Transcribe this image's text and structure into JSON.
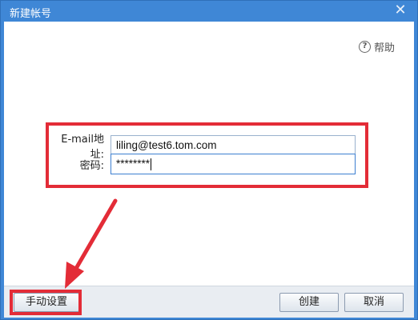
{
  "window": {
    "title": "新建帐号"
  },
  "help": {
    "label": "帮助"
  },
  "form": {
    "email_label": "E-mail地址:",
    "email_value": "liling@test6.tom.com",
    "password_label": "密码:",
    "password_value": "********"
  },
  "footer": {
    "manual_label": "手动设置",
    "create_label": "创建",
    "cancel_label": "取消"
  },
  "icons": {
    "close": "close-icon",
    "help": "help-icon"
  },
  "colors": {
    "titlebar": "#3f87d6",
    "highlight": "#e32c37"
  }
}
